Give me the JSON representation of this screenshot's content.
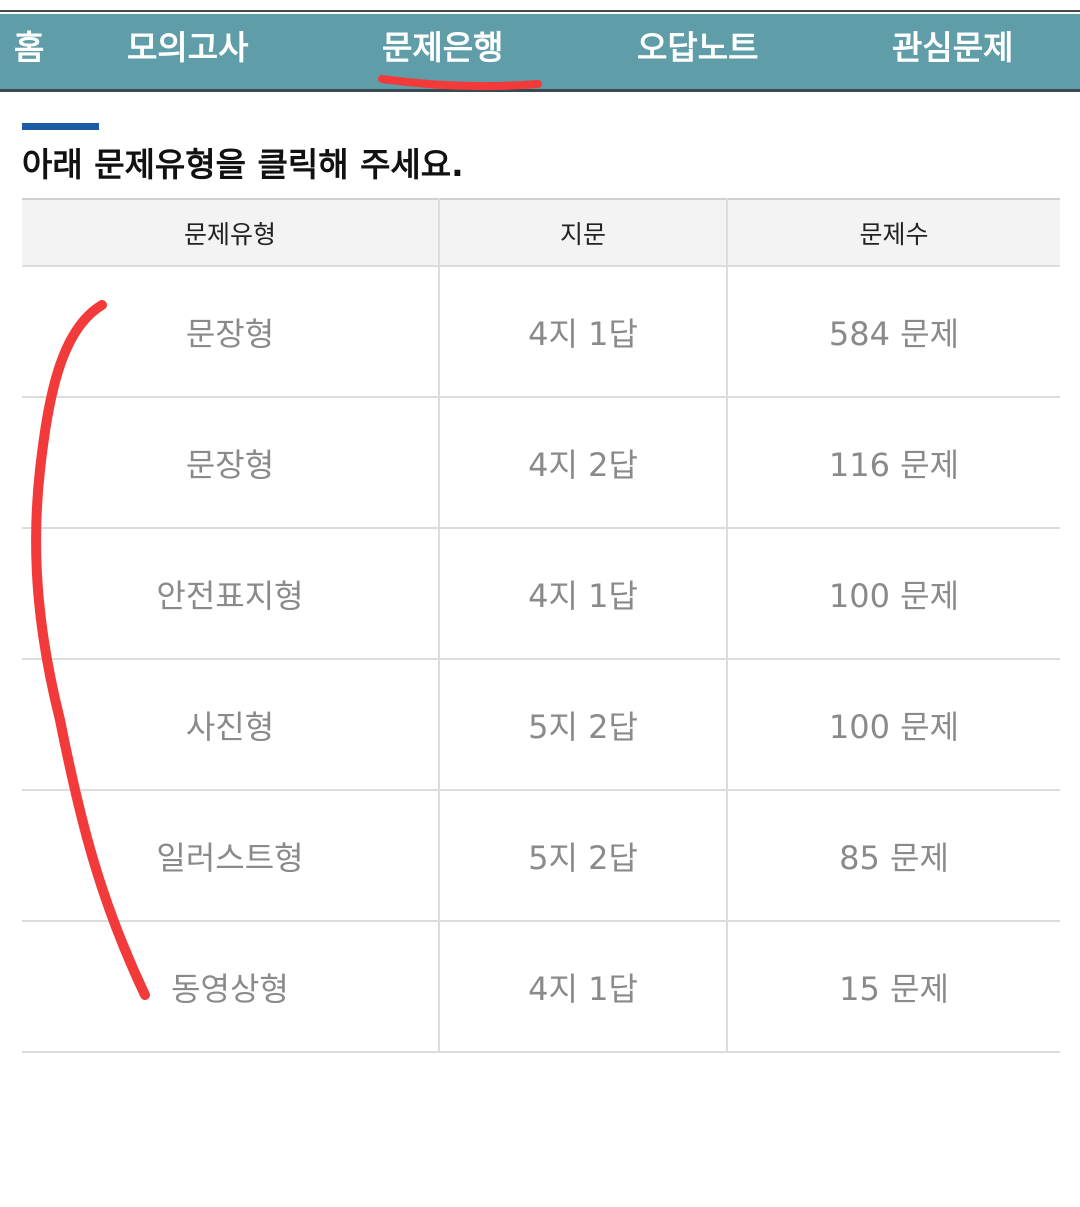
{
  "nav": {
    "items": [
      {
        "label": "홈"
      },
      {
        "label": "모의고사"
      },
      {
        "label": "문제은행"
      },
      {
        "label": "오답노트"
      },
      {
        "label": "관심문제"
      }
    ],
    "active_index": 2
  },
  "instruction": "아래 문제유형을 클릭해 주세요.",
  "table": {
    "headers": [
      "문제유형",
      "지문",
      "문제수"
    ],
    "rows": [
      {
        "type": "문장형",
        "choice": "4지 1답",
        "count": "584 문제"
      },
      {
        "type": "문장형",
        "choice": "4지 2답",
        "count": "116 문제"
      },
      {
        "type": "안전표지형",
        "choice": "4지 1답",
        "count": "100 문제"
      },
      {
        "type": "사진형",
        "choice": "5지 2답",
        "count": "100 문제"
      },
      {
        "type": "일러스트형",
        "choice": "5지 2답",
        "count": "85 문제"
      },
      {
        "type": "동영상형",
        "choice": "4지 1답",
        "count": "15 문제"
      }
    ]
  },
  "colors": {
    "navbar": "#5f9ea8",
    "accent_bar": "#1a5aa6",
    "annotation": "#f23a3a",
    "cell_text": "#8a8a8a"
  }
}
